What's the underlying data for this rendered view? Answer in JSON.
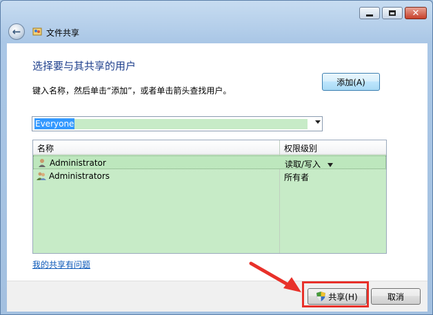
{
  "window": {
    "title": "文件共享",
    "controls": {
      "minimize": "minimize-icon",
      "maximize": "maximize-icon",
      "close": "close-icon"
    },
    "back_icon": "back-arrow-icon"
  },
  "main": {
    "heading": "选择要与其共享的用户",
    "instruction": "键入名称，然后单击“添加”，或者单击箭头查找用户。",
    "user_input": {
      "value": "Everyone"
    },
    "add_button": "添加(A)",
    "table": {
      "columns": [
        "名称",
        "权限级别"
      ],
      "rows": [
        {
          "name": "Administrator",
          "permission": "读取/写入",
          "icon": "user-icon"
        },
        {
          "name": "Administrators",
          "permission": "所有者",
          "icon": "group-icon"
        }
      ]
    },
    "help_link": "我的共享有问题"
  },
  "footer": {
    "share_button": "共享(H)",
    "cancel_button": "取消"
  },
  "colors": {
    "selection_bg": "#c7ebc7",
    "heading": "#1e3f8c",
    "highlight": "#e8312a"
  }
}
